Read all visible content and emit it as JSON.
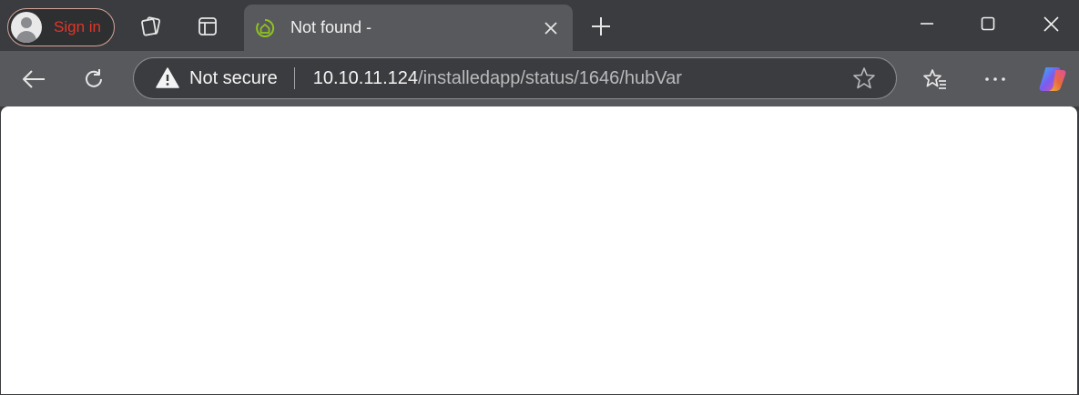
{
  "profile": {
    "label": "Sign in",
    "icon": "avatar-icon"
  },
  "tabstrip": {
    "workspaces_icon": "workspaces-icon",
    "tab_actions_icon": "tab-actions-icon",
    "new_tab_icon": "plus-icon"
  },
  "tab": {
    "title": "Not found -",
    "favicon": "hubitat-icon",
    "close_icon": "close-icon"
  },
  "window_controls": {
    "minimize": "minimize-icon",
    "maximize": "maximize-icon",
    "close": "close-icon"
  },
  "toolbar": {
    "back_icon": "back-arrow-icon",
    "refresh_icon": "refresh-icon",
    "favorites_icon": "favorites-icon",
    "menu_icon": "more-icon",
    "copilot_icon": "copilot-icon"
  },
  "omnibox": {
    "security_label": "Not secure",
    "url_host": "10.10.11.124",
    "url_path": "/installedapp/status/1646/hubVar",
    "star_icon": "star-icon"
  },
  "colors": {
    "chrome_dark": "#3b3c3f",
    "chrome_tab": "#58595c",
    "signin_text": "#e0362a",
    "favicon_green": "#8fc31f"
  }
}
